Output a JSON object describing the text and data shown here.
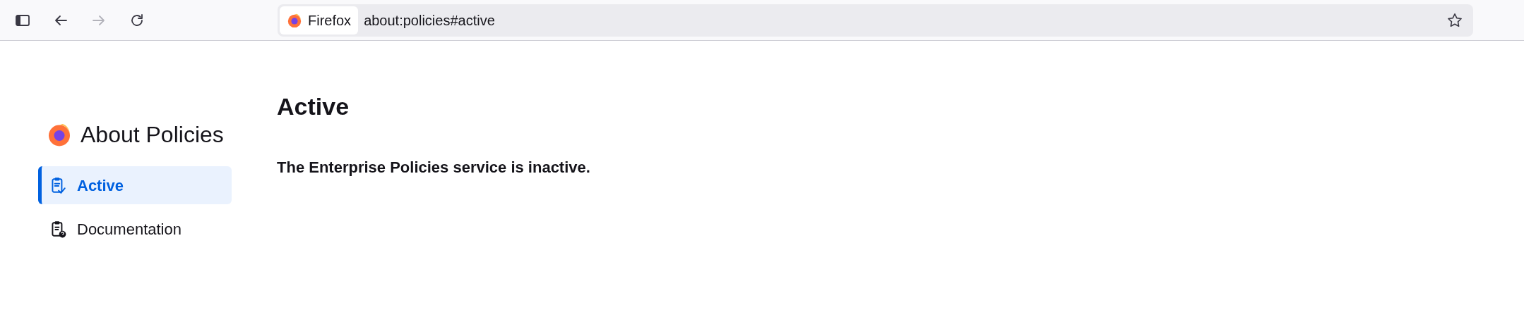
{
  "toolbar": {
    "buttons": [
      {
        "kind": "sidebar",
        "disabled": false
      },
      {
        "kind": "back",
        "disabled": false
      },
      {
        "kind": "forward",
        "disabled": true
      },
      {
        "kind": "reload",
        "disabled": false
      }
    ],
    "identity": "Firefox",
    "url": "about:policies#active"
  },
  "sidebar": {
    "title": "About Policies",
    "items": [
      {
        "kind": "active",
        "label": "Active",
        "selected": true
      },
      {
        "kind": "documentation",
        "label": "Documentation",
        "selected": false
      }
    ]
  },
  "main": {
    "heading": "Active",
    "message": "The Enterprise Policies service is inactive."
  }
}
